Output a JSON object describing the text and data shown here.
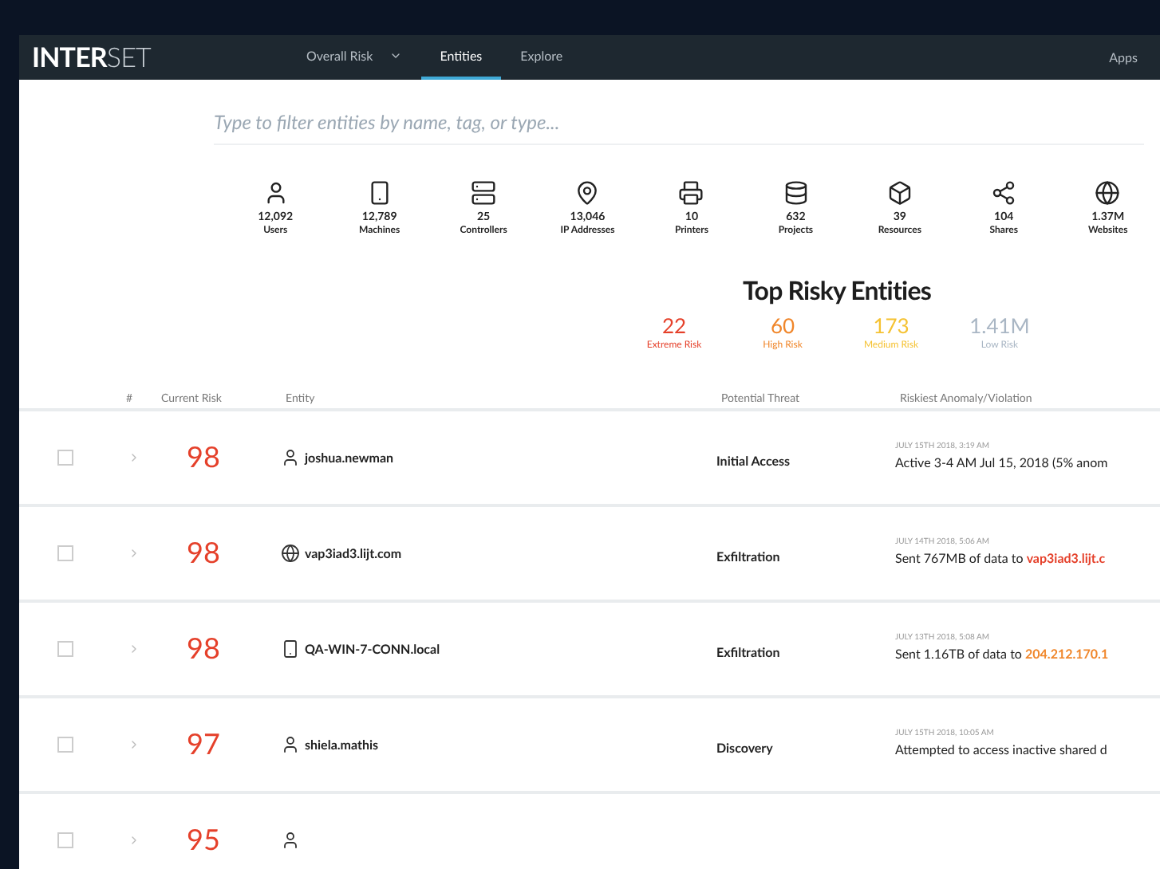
{
  "brand": {
    "bold": "INTER",
    "light": "SET"
  },
  "nav": [
    {
      "label": "Overall Risk",
      "selected": false,
      "dropdown": true
    },
    {
      "label": "Entities",
      "selected": true,
      "dropdown": false
    },
    {
      "label": "Explore",
      "selected": false,
      "dropdown": false
    }
  ],
  "nav_right": "Apps",
  "search": {
    "placeholder": "Type to filter entities by name, tag, or type..."
  },
  "entity_types": [
    {
      "kind": "user",
      "count": "12,092",
      "label": "Users"
    },
    {
      "kind": "machine",
      "count": "12,789",
      "label": "Machines"
    },
    {
      "kind": "controller",
      "count": "25",
      "label": "Controllers"
    },
    {
      "kind": "ip",
      "count": "13,046",
      "label": "IP Addresses"
    },
    {
      "kind": "printer",
      "count": "10",
      "label": "Printers"
    },
    {
      "kind": "project",
      "count": "632",
      "label": "Projects"
    },
    {
      "kind": "resource",
      "count": "39",
      "label": "Resources"
    },
    {
      "kind": "share",
      "count": "104",
      "label": "Shares"
    },
    {
      "kind": "website",
      "count": "1.37M",
      "label": "Websites"
    }
  ],
  "summary": {
    "title": "Top Risky Entities",
    "levels": [
      {
        "value": "22",
        "label": "Extreme Risk",
        "color": "#e5402a"
      },
      {
        "value": "60",
        "label": "High Risk",
        "color": "#f0862a"
      },
      {
        "value": "173",
        "label": "Medium Risk",
        "color": "#f5c232"
      },
      {
        "value": "1.41M",
        "label": "Low Risk",
        "color": "#a9b6c4"
      }
    ]
  },
  "table": {
    "columns": [
      "#",
      "Current Risk",
      "Entity",
      "Potential Threat",
      "Riskiest Anomaly/Violation"
    ],
    "rows": [
      {
        "checked": false,
        "risk": "98",
        "kind": "user",
        "entity": "joshua.newman",
        "threat": "Initial Access",
        "time": "JULY 15TH 2018, 3:19 AM",
        "anomaly": "Active 3-4 AM Jul 15, 2018 (5% anom"
      },
      {
        "checked": false,
        "risk": "98",
        "kind": "website",
        "entity": "vap3iad3.lijt.com",
        "threat": "Exfiltration",
        "time": "JULY 14TH 2018, 5:06 AM",
        "anomaly": "Sent 767MB of data to ",
        "target": {
          "text": "vap3iad3.lijt.c",
          "color": "#e5402a"
        }
      },
      {
        "checked": false,
        "risk": "98",
        "kind": "machine",
        "entity": "QA-WIN-7-CONN.local",
        "threat": "Exfiltration",
        "time": "JULY 13TH 2018, 5:08 AM",
        "anomaly": "Sent 1.16TB of data to ",
        "target": {
          "text": "204.212.170.1",
          "color": "#f0862a"
        }
      },
      {
        "checked": false,
        "risk": "97",
        "kind": "user",
        "entity": "shiela.mathis",
        "threat": "Discovery",
        "time": "JULY 15TH 2018, 10:05 AM",
        "anomaly": "Attempted to access inactive shared d"
      },
      {
        "checked": false,
        "risk": "95",
        "kind": "user"
      }
    ]
  }
}
